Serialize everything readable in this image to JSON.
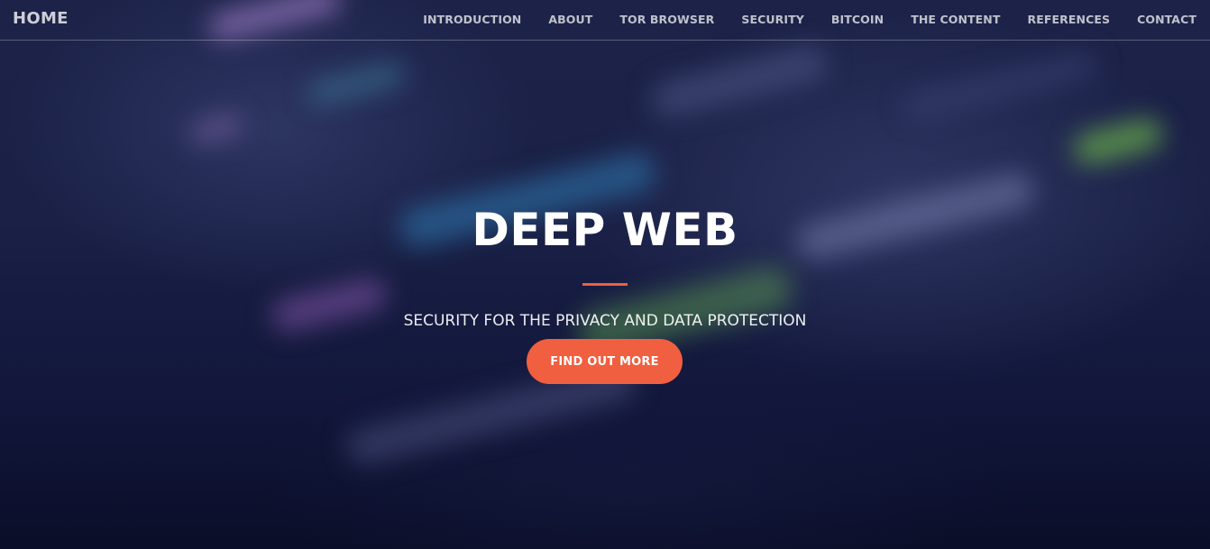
{
  "nav": {
    "brand": "HOME",
    "items": [
      {
        "label": "INTRODUCTION"
      },
      {
        "label": "ABOUT"
      },
      {
        "label": "TOR BROWSER"
      },
      {
        "label": "SECURITY"
      },
      {
        "label": "BITCOIN"
      },
      {
        "label": "THE CONTENT"
      },
      {
        "label": "REFERENCES"
      },
      {
        "label": "CONTACT"
      }
    ]
  },
  "hero": {
    "title": "DEEP WEB",
    "subtitle": "SECURITY FOR THE PRIVACY AND DATA PROTECTION",
    "cta_label": "FIND OUT MORE"
  },
  "colors": {
    "accent": "#f05f40",
    "background": "#1a2046"
  }
}
